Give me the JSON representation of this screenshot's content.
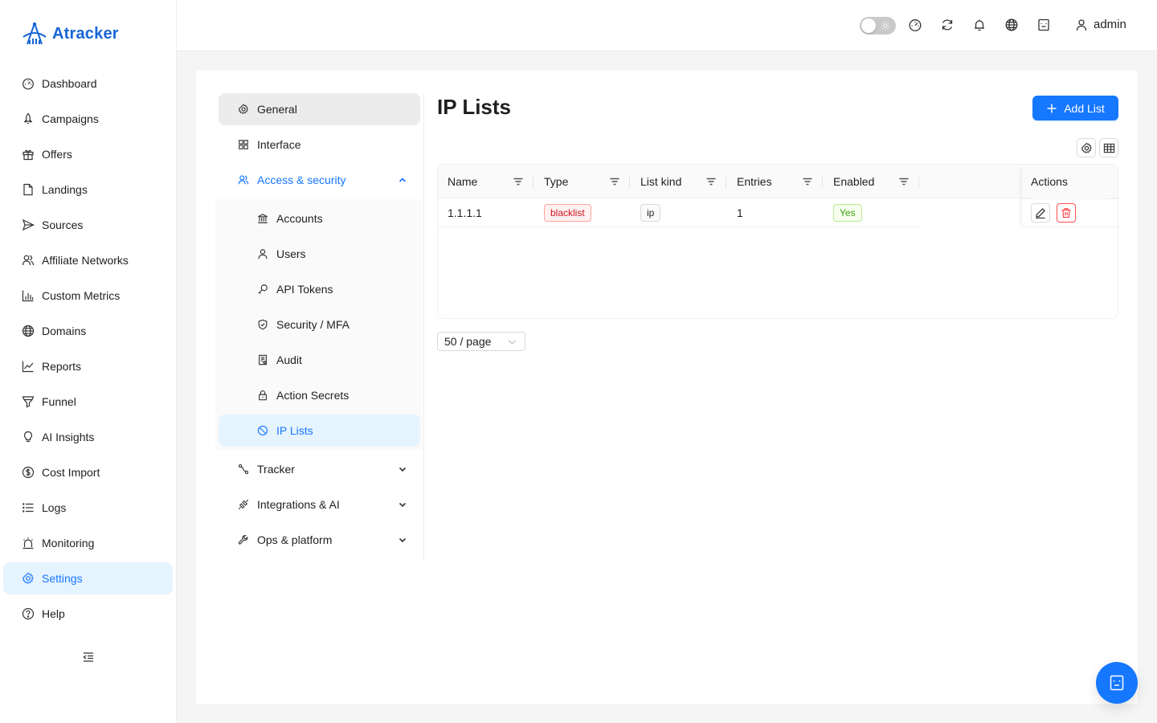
{
  "app": {
    "name": "Atracker"
  },
  "sidebar": {
    "items": [
      {
        "label": "Dashboard",
        "icon": "dashboard-icon"
      },
      {
        "label": "Campaigns",
        "icon": "rocket-icon"
      },
      {
        "label": "Offers",
        "icon": "gift-icon"
      },
      {
        "label": "Landings",
        "icon": "file-icon"
      },
      {
        "label": "Sources",
        "icon": "send-icon"
      },
      {
        "label": "Affiliate Networks",
        "icon": "team-icon"
      },
      {
        "label": "Custom Metrics",
        "icon": "bar-chart-icon"
      },
      {
        "label": "Domains",
        "icon": "globe-icon"
      },
      {
        "label": "Reports",
        "icon": "line-chart-icon"
      },
      {
        "label": "Funnel",
        "icon": "funnel-icon"
      },
      {
        "label": "AI Insights",
        "icon": "bulb-icon"
      },
      {
        "label": "Cost Import",
        "icon": "dollar-icon"
      },
      {
        "label": "Logs",
        "icon": "list-icon"
      },
      {
        "label": "Monitoring",
        "icon": "alarm-icon"
      },
      {
        "label": "Settings",
        "icon": "gear-icon",
        "active": true
      },
      {
        "label": "Help",
        "icon": "question-icon"
      }
    ]
  },
  "header": {
    "user": "admin"
  },
  "settings_menu": {
    "general": "General",
    "interface": "Interface",
    "access_security": "Access & security",
    "accounts": "Accounts",
    "users": "Users",
    "api_tokens": "API Tokens",
    "security_mfa": "Security / MFA",
    "audit": "Audit",
    "action_secrets": "Action Secrets",
    "ip_lists": "IP Lists",
    "tracker": "Tracker",
    "integrations_ai": "Integrations & AI",
    "ops_platform": "Ops & platform"
  },
  "main": {
    "title": "IP Lists",
    "add_button": "Add List",
    "columns": {
      "name": "Name",
      "type": "Type",
      "list_kind": "List kind",
      "entries": "Entries",
      "enabled": "Enabled",
      "actions": "Actions"
    },
    "rows": [
      {
        "name": "1.1.1.1",
        "type": "blacklist",
        "list_kind": "ip",
        "entries": "1",
        "enabled": "Yes"
      }
    ],
    "page_size": "50 / page"
  },
  "colors": {
    "primary": "#1677ff",
    "brand": "#1765d6",
    "danger": "#ff4d4f",
    "success": "#389e0d"
  }
}
